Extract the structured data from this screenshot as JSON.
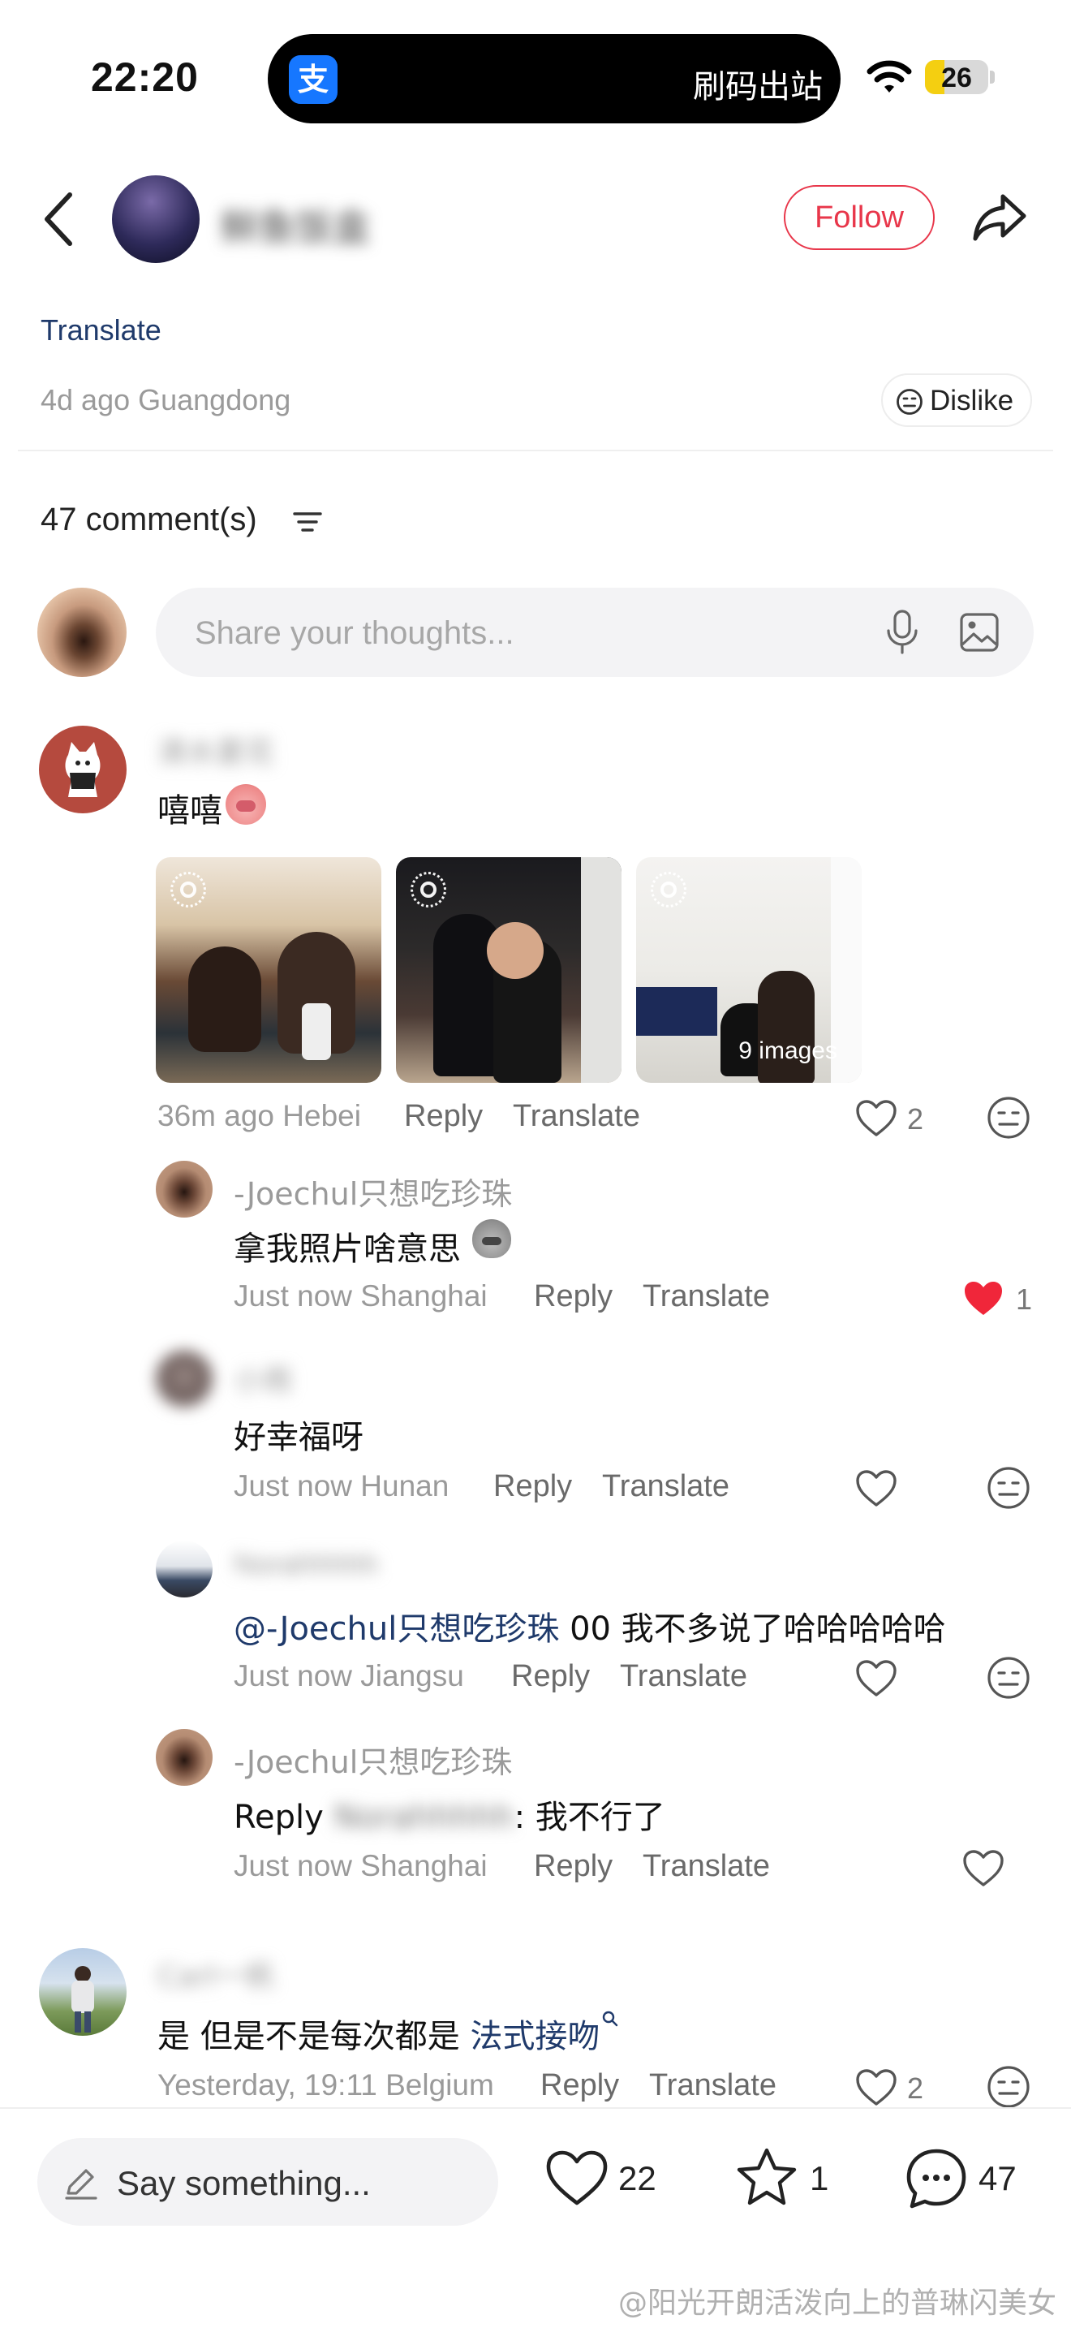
{
  "status_bar": {
    "time": "22:20",
    "island_app_icon": "支",
    "island_text": "刷码出站",
    "battery": "26",
    "wifi_icon": "wifi-icon"
  },
  "header": {
    "username": "鲜鱼饭盒",
    "follow_label": "Follow"
  },
  "post": {
    "translate_label": "Translate",
    "meta": "4d ago Guangdong",
    "dislike_label": "Dislike"
  },
  "comments_section": {
    "count_label": "47 comment(s)",
    "input_placeholder": "Share your thoughts..."
  },
  "comments": [
    {
      "username": "清水夏花",
      "text": "嘻嘻",
      "images_label": "9 images",
      "time": "36m ago Hebei",
      "reply": "Reply",
      "translate": "Translate",
      "likes": "2",
      "replies": [
        {
          "username": "-Joechul只想吃珍珠",
          "text": "拿我照片啥意思",
          "time": "Just now Shanghai",
          "reply": "Reply",
          "translate": "Translate",
          "likes": "1",
          "liked": true
        },
        {
          "username": "小雨",
          "text": "好幸福呀",
          "time": "Just now Hunan",
          "reply": "Reply",
          "translate": "Translate"
        },
        {
          "username": "Norahhhhh",
          "mention": "@-Joechul只想吃珍珠",
          "text": " 00 我不多说了哈哈哈哈哈",
          "time": "Just now Jiangsu",
          "reply": "Reply",
          "translate": "Translate"
        },
        {
          "username": "-Joechul只想吃珍珠",
          "text_prefix": "Reply ",
          "reply_to": "Norahhhhh",
          "text": ": 我不行了",
          "time": "Just now Shanghai",
          "reply": "Reply",
          "translate": "Translate"
        }
      ]
    },
    {
      "username": "Carl一帆",
      "text": "是 但是不是每次都是 ",
      "link": "法式接吻",
      "time": "Yesterday, 19:11 Belgium",
      "reply": "Reply",
      "translate": "Translate",
      "likes": "2"
    }
  ],
  "bottom_bar": {
    "placeholder": "Say something...",
    "likes": "22",
    "stars": "1",
    "comments": "47"
  },
  "watermark": "@阳光开朗活泼向上的普琳闪美女",
  "colors": {
    "accent_red": "#e8364a",
    "link_blue": "#1f3a6b",
    "liked_heart": "#f0263a"
  }
}
